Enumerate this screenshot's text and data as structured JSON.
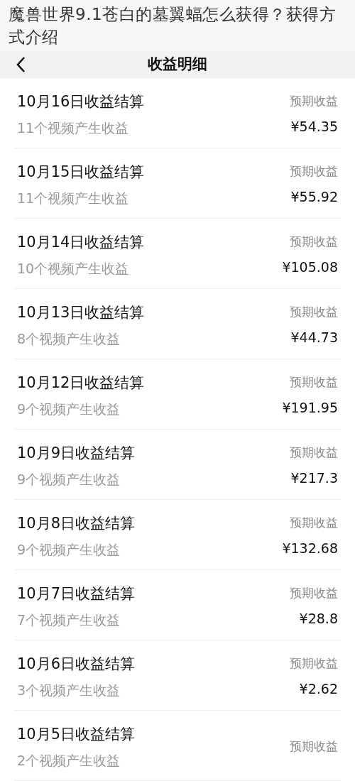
{
  "caption": "魔兽世界9.1苍白的墓翼蝠怎么获得？获得方式介绍",
  "header": {
    "title": "收益明细"
  },
  "rows": [
    {
      "title": "10月16日收益结算",
      "subtitle": "11个视频产生收益",
      "label": "预期收益",
      "amount": "¥54.35"
    },
    {
      "title": "10月15日收益结算",
      "subtitle": "11个视频产生收益",
      "label": "预期收益",
      "amount": "¥55.92"
    },
    {
      "title": "10月14日收益结算",
      "subtitle": "10个视频产生收益",
      "label": "预期收益",
      "amount": "¥105.08"
    },
    {
      "title": "10月13日收益结算",
      "subtitle": "8个视频产生收益",
      "label": "预期收益",
      "amount": "¥44.73"
    },
    {
      "title": "10月12日收益结算",
      "subtitle": "9个视频产生收益",
      "label": "预期收益",
      "amount": "¥191.95"
    },
    {
      "title": "10月9日收益结算",
      "subtitle": "9个视频产生收益",
      "label": "预期收益",
      "amount": "¥217.3"
    },
    {
      "title": "10月8日收益结算",
      "subtitle": "9个视频产生收益",
      "label": "预期收益",
      "amount": "¥132.68"
    },
    {
      "title": "10月7日收益结算",
      "subtitle": "7个视频产生收益",
      "label": "预期收益",
      "amount": "¥28.8"
    },
    {
      "title": "10月6日收益结算",
      "subtitle": "3个视频产生收益",
      "label": "预期收益",
      "amount": "¥2.62"
    },
    {
      "title": "10月5日收益结算",
      "subtitle": "2个视频产生收益",
      "label": "预期收益"
    }
  ]
}
